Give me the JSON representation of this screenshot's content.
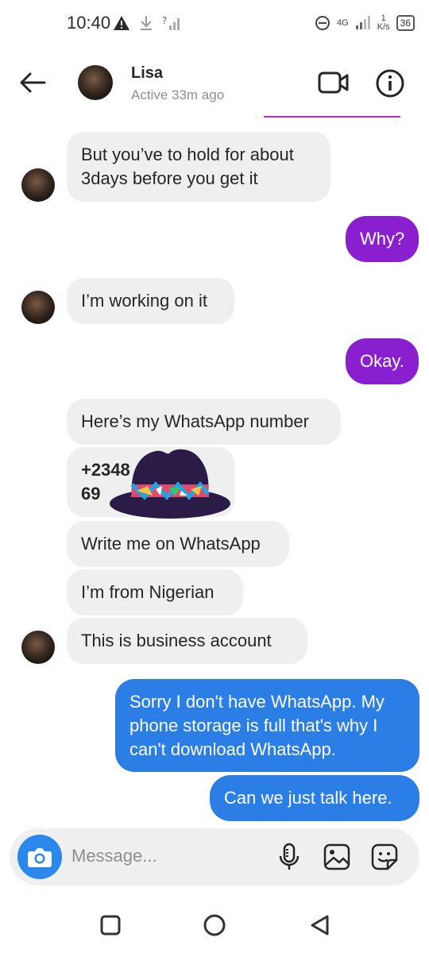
{
  "status_bar": {
    "time": "10:40",
    "network": "4G",
    "speed_value": "1",
    "speed_unit": "K/s",
    "battery": "36"
  },
  "header": {
    "contact_name": "Lisa",
    "status": "Active 33m ago",
    "icons": [
      "back-arrow-icon",
      "video-call-icon",
      "info-icon"
    ]
  },
  "messages": [
    {
      "from": "contact",
      "lines": [
        "But you’ve to hold for about",
        "3days before you get it"
      ]
    },
    {
      "from": "me",
      "lines": [
        "Why?"
      ]
    },
    {
      "from": "contact",
      "lines": [
        "I’m working on it"
      ]
    },
    {
      "from": "me",
      "lines": [
        "Okay."
      ]
    },
    {
      "from": "contact",
      "lines": [
        "Here’s my WhatsApp number"
      ]
    },
    {
      "from": "contact",
      "lines": [
        "+2348",
        "69"
      ]
    },
    {
      "from": "contact",
      "lines": [
        "Write me on WhatsApp"
      ]
    },
    {
      "from": "contact",
      "lines": [
        "I’m from Nigerian"
      ]
    },
    {
      "from": "contact",
      "lines": [
        "This is business account"
      ]
    },
    {
      "from": "me",
      "lines": [
        "Sorry I don't have WhatsApp. My",
        "phone storage is full that's why I",
        "can't download WhatsApp."
      ]
    },
    {
      "from": "me",
      "lines": [
        "Can we just talk here."
      ]
    }
  ],
  "composer": {
    "placeholder": "Message...",
    "icons": [
      "camera-icon",
      "microphone-icon",
      "gallery-icon",
      "sticker-icon"
    ]
  },
  "colors": {
    "outgoing_purple": "#8a1fd0",
    "outgoing_blue": "#2a7ee6",
    "incoming": "#efefef",
    "camera_button": "#2a88ec"
  }
}
